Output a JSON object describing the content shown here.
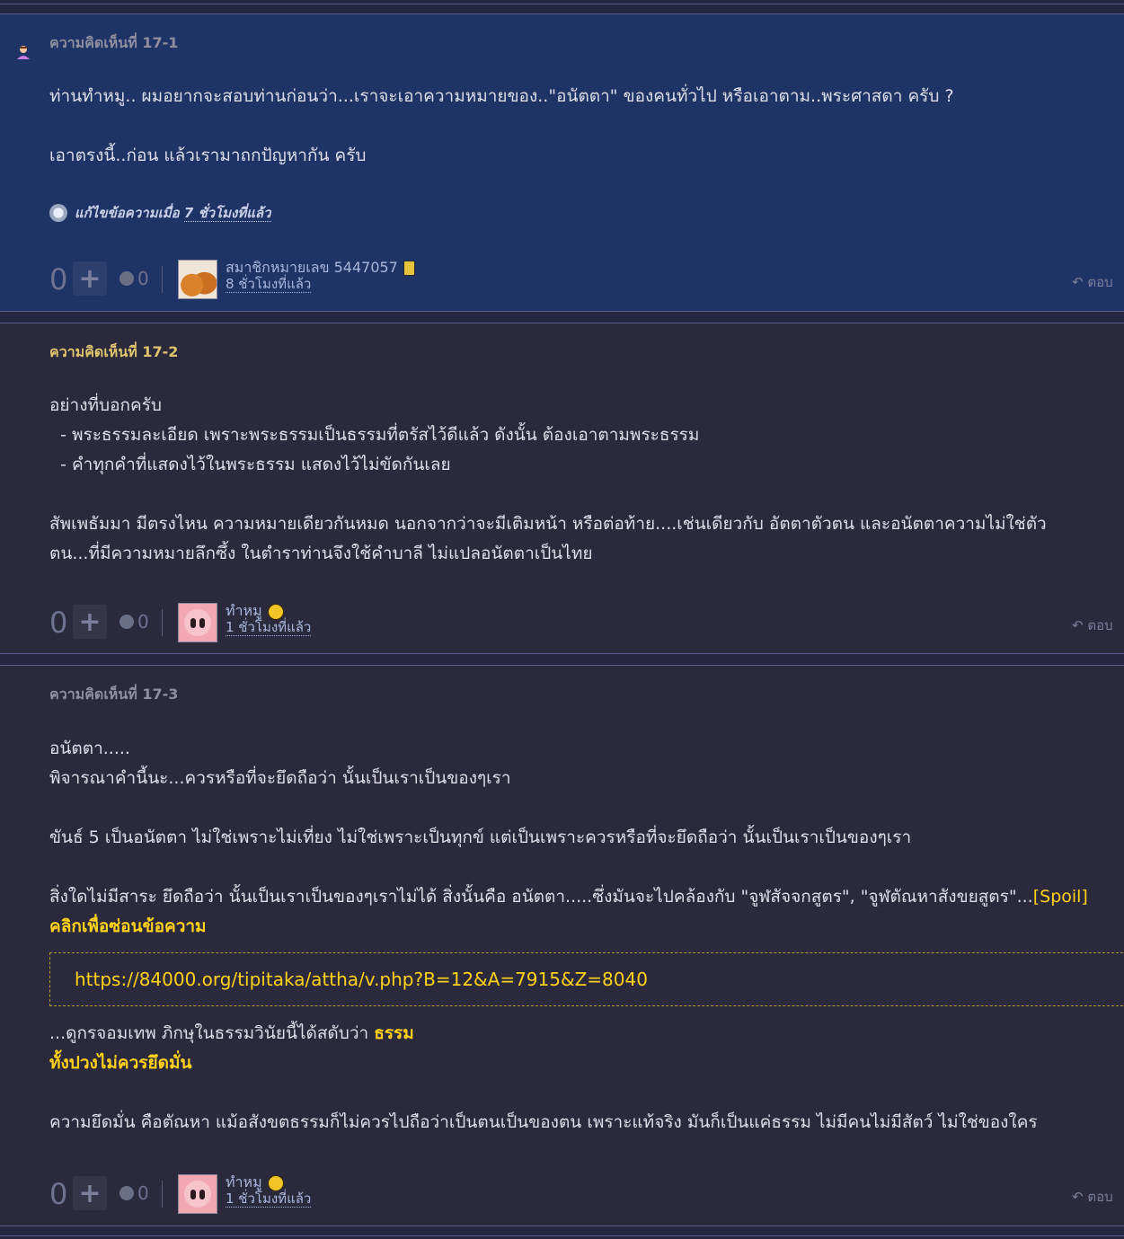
{
  "comments": [
    {
      "title": "ความคิดเห็นที่ 17-1",
      "lines": [
        "ท่านทำหมู.. ผมอยากจะสอบท่านก่อนว่า...เราจะเอาความหมายของ..\"อนัตตา\"  ของคนทั่วไป หรือเอาตาม..พระศาสดา ครับ ?",
        "",
        "เอาตรงนี้..ก่อน  แล้วเรามาถกปัญหากัน ครับ"
      ],
      "edit_prefix": "แก้ไขข้อความเมื่อ ",
      "edit_time": "7 ชั่วโมงที่แล้ว",
      "score": "0",
      "emo_count": "0",
      "user_name": "สมาชิกหมายเลข 5447057",
      "user_time": "8 ชั่วโมงที่แล้ว",
      "reply_label": "ตอบ"
    },
    {
      "title": "ความคิดเห็นที่ 17-2",
      "lines": [
        "อย่างที่บอกครับ",
        "  - พระธรรมละเอียด เพราะพระธรรมเป็นธรรมที่ตรัสไว้ดีแล้ว ดังนั้น ต้องเอาตามพระธรรม",
        "  - คำทุกคำที่แสดงไว้ในพระธรรม แสดงไว้ไม่ขัดกันเลย",
        "",
        "สัพเพธัมมา มีตรงไหน ความหมายเดียวกันหมด นอกจากว่าจะมีเติมหน้า หรือต่อท้าย....เช่นเดียวกับ อัตตาตัวตน และอนัตตาความไม่ใช่ตัว",
        "ตน...ที่มีความหมายลึกซึ้ง ในตำราท่านจึงใช้คำบาลี ไม่แปลอนัตตาเป็นไทย"
      ],
      "score": "0",
      "emo_count": "0",
      "user_name": "ทำหมู",
      "user_time": "1 ชั่วโมงที่แล้ว",
      "reply_label": "ตอบ"
    },
    {
      "title": "ความคิดเห็นที่ 17-3",
      "lines_a": [
        "อนัตตา.....",
        "พิจารณาคำนี้นะ...ควรหรือที่จะยึดถือว่า นั้นเป็นเราเป็นของๆเรา",
        "",
        "ขันธ์ 5 เป็นอนัตตา ไม่ใช่เพราะไม่เที่ยง ไม่ใช่เพราะเป็นทุกข์ แต่เป็นเพราะควรหรือที่จะยึดถือว่า นั้นเป็นเราเป็นของๆเรา",
        ""
      ],
      "spoiler_line_text": "สิ่งใดไม่มีสาระ ยึดถือว่า นั้นเป็นเราเป็นของๆเราไม่ได้ สิ่งนั้นคือ อนัตตา.....ซึ่งมันจะไปคล้องกับ \"จูฬสัจจกสูตร\",  \"จูฬตัณหาสังขยสูตร\"...",
      "spoiler_tag": "[Spoil]",
      "spoiler_hide": "คลิกเพื่อซ่อนข้อความ",
      "spoiler_link": "https://84000.org/tipitaka/attha/v.php?B=12&A=7915&Z=8040",
      "quote_plain": "...ดูกรจอมเทพ ภิกษุในธรรมวินัยนี้ได้สดับว่า ",
      "quote_hl1": "ธรรม",
      "quote_hl2": "ทั้งปวงไม่ควรยึดมั่น",
      "closing": "ความยึดมั่น คือตัณหา แม้อสังขตธรรมก็ไม่ควรไปถือว่าเป็นตนเป็นของตน เพราะแท้จริง มันก็เป็นแค่ธรรม ไม่มีคนไม่มีสัตว์ ไม่ใช่ของใคร",
      "score": "0",
      "emo_count": "0",
      "user_name": "ทำหมู",
      "user_time": "1 ชั่วโมงที่แล้ว",
      "reply_label": "ตอบ"
    }
  ],
  "icons": {
    "plus": "+",
    "reply": "↶"
  }
}
